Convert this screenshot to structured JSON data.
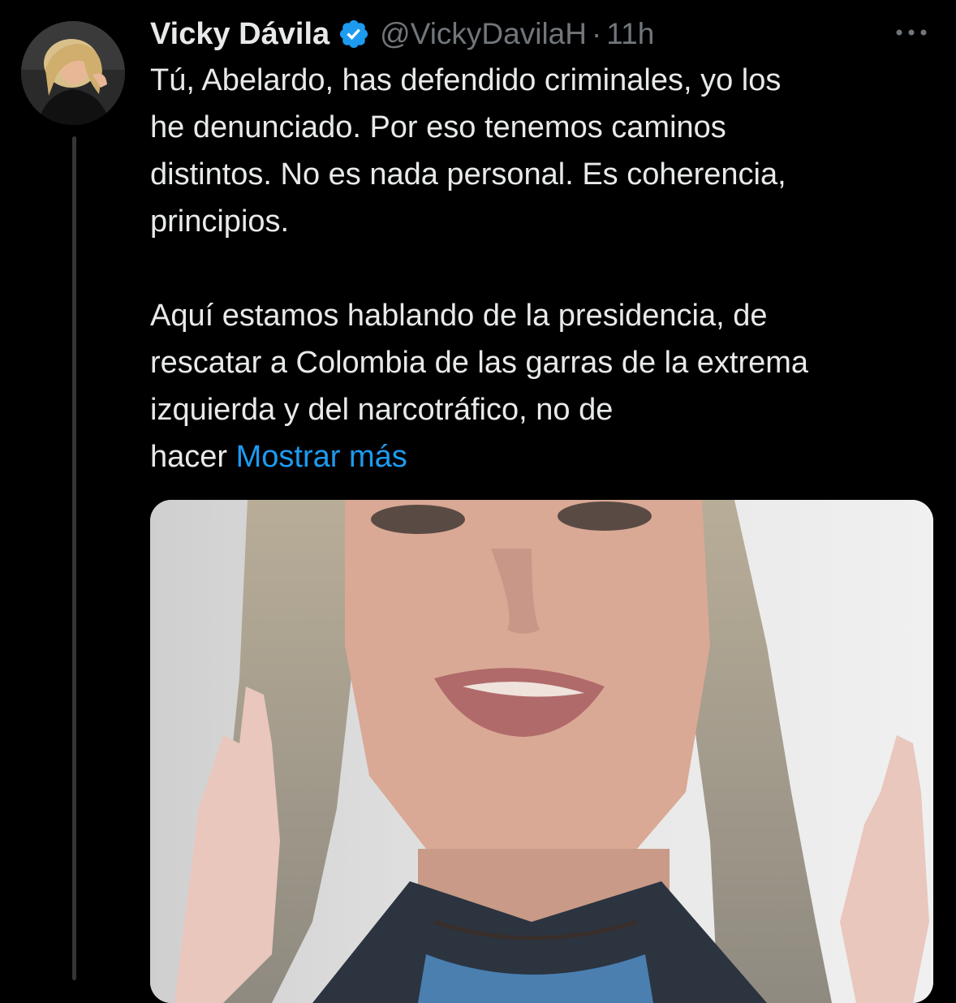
{
  "tweet": {
    "author_name": "Vicky Dávila",
    "handle": "@VickyDavilaH",
    "separator": "·",
    "time": "11h",
    "text_lines_1": [
      "Tú, Abelardo, has defendido criminales, yo los",
      "he denunciado. Por eso tenemos caminos",
      "distintos. No es nada personal. Es coherencia,",
      "principios."
    ],
    "text_lines_2": [
      "Aquí estamos hablando de la presidencia, de",
      "rescatar a Colombia de las garras de la extrema",
      "izquierda y del narcotráfico, no de"
    ],
    "last_line_text": "hacer",
    "show_more_label": "Mostrar más"
  },
  "icons": {
    "verified": "verified-badge-icon",
    "more": "more-horizontal-icon"
  },
  "colors": {
    "background": "#000000",
    "text": "#e7e9ea",
    "secondary": "#71767b",
    "accent": "#1d9bf0"
  }
}
